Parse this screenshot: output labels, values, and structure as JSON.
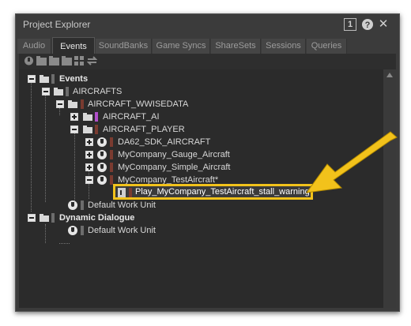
{
  "window": {
    "title": "Project Explorer"
  },
  "tabs": [
    {
      "label": "Audio"
    },
    {
      "label": "Events"
    },
    {
      "label": "SoundBanks"
    },
    {
      "label": "Game Syncs"
    },
    {
      "label": "ShareSets"
    },
    {
      "label": "Sessions"
    },
    {
      "label": "Queries"
    }
  ],
  "active_tab": "Events",
  "window_buttons": {
    "one": "1",
    "help": "?",
    "close": "✕"
  },
  "tree": {
    "events": "Events",
    "aircrafts": "AIRCRAFTS",
    "wwisedata": "AIRCRAFT_WWISEDATA",
    "aircraft_ai": "AIRCRAFT_AI",
    "aircraft_player": "AIRCRAFT_PLAYER",
    "da62": "DA62_SDK_AIRCRAFT",
    "gauge": "MyCompany_Gauge_Aircraft",
    "simple": "MyCompany_Simple_Aircraft",
    "test": "MyCompany_TestAircraft*",
    "play": "Play_MyCompany_TestAircraft_stall_warning",
    "dwu1": "Default Work Unit",
    "dynamic": "Dynamic Dialogue",
    "dwu2": "Default Work Unit"
  },
  "colors": {
    "accent_highlight": "#f2c21b",
    "ai_bar": "#b04fc9",
    "bar_dark": "#7a3b30",
    "bar_gray": "#6c6c6c"
  }
}
